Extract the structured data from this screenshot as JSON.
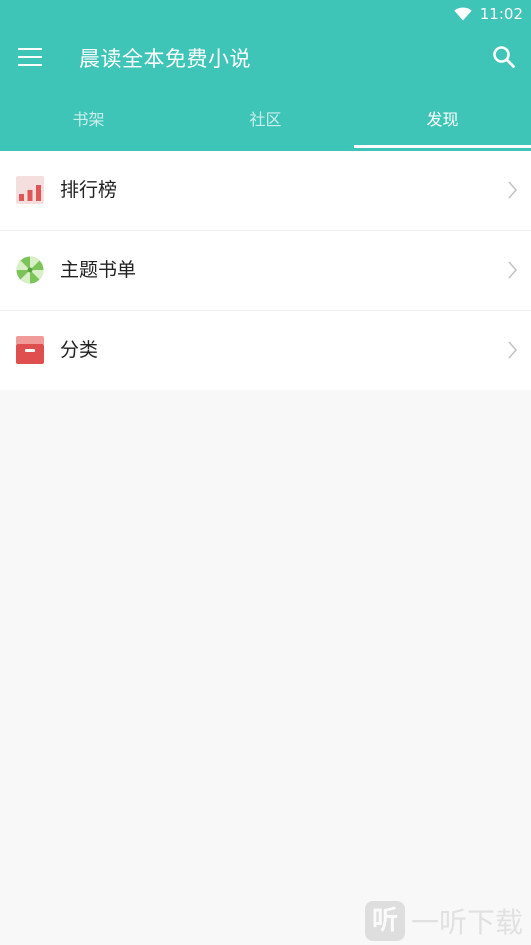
{
  "status_bar": {
    "time": "11:02",
    "icons": [
      "wifi-icon"
    ]
  },
  "appbar": {
    "title": "晨读全本免费小说",
    "menu_icon": "menu-icon",
    "search_icon": "search-icon"
  },
  "tabs": [
    {
      "label": "书架",
      "active": false
    },
    {
      "label": "社区",
      "active": false
    },
    {
      "label": "发现",
      "active": true
    }
  ],
  "discover_list": [
    {
      "label": "排行榜",
      "icon": "ranking-chart-icon"
    },
    {
      "label": "主题书单",
      "icon": "candy-icon"
    },
    {
      "label": "分类",
      "icon": "drawer-box-icon"
    }
  ],
  "watermark": {
    "glyph": "听",
    "text": "一听下载"
  },
  "colors": {
    "accent": "#3fc4b8",
    "background": "#f8f8f8"
  }
}
